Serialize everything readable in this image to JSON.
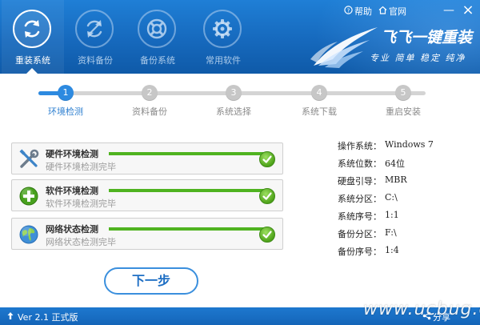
{
  "header": {
    "nav": [
      {
        "label": "重装系统",
        "icon": "refresh-icon",
        "active": true
      },
      {
        "label": "资料备份",
        "icon": "backup-sync-icon",
        "active": false
      },
      {
        "label": "备份系统",
        "icon": "lifebuoy-icon",
        "active": false
      },
      {
        "label": "常用软件",
        "icon": "gear-icon",
        "active": false
      }
    ],
    "help": "帮助",
    "website": "官网",
    "minimize": "—",
    "close": "×",
    "brand_title": "飞飞一键重装",
    "brand_slogan": "专业 简单 稳定 纯净"
  },
  "steps": [
    {
      "num": "1",
      "label": "环境检测",
      "active": true
    },
    {
      "num": "2",
      "label": "资料备份",
      "active": false
    },
    {
      "num": "3",
      "label": "系统选择",
      "active": false
    },
    {
      "num": "4",
      "label": "系统下载",
      "active": false
    },
    {
      "num": "5",
      "label": "重启安装",
      "active": false
    }
  ],
  "checks": [
    {
      "title": "硬件环境检测",
      "status": "硬件环境检测完毕",
      "icon": "tools-icon",
      "progress": 1.0
    },
    {
      "title": "软件环境检测",
      "status": "软件环境检测完毕",
      "icon": "plus-icon",
      "progress": 1.0
    },
    {
      "title": "网络状态检测",
      "status": "网络状态检测完毕",
      "icon": "globe-icon",
      "progress": 1.0
    }
  ],
  "info": [
    {
      "key": "操作系统：",
      "value": "Windows 7"
    },
    {
      "key": "系统位数：",
      "value": "64位"
    },
    {
      "key": "硬盘引导：",
      "value": "MBR"
    },
    {
      "key": "系统分区：",
      "value": "C:\\"
    },
    {
      "key": "系统序号：",
      "value": "1:1"
    },
    {
      "key": "备份分区：",
      "value": "F:\\"
    },
    {
      "key": "备份序号：",
      "value": "1:4"
    }
  ],
  "next_button": "下一步",
  "footer": {
    "version": "Ver 2.1 正式版",
    "share": "分享"
  },
  "watermark": "www.ucbug.cc",
  "colors": {
    "header_blue": "#1669bd",
    "step_active": "#2d8ae0",
    "progress_green": "#4fb320",
    "check_green": "#4fa31a"
  }
}
